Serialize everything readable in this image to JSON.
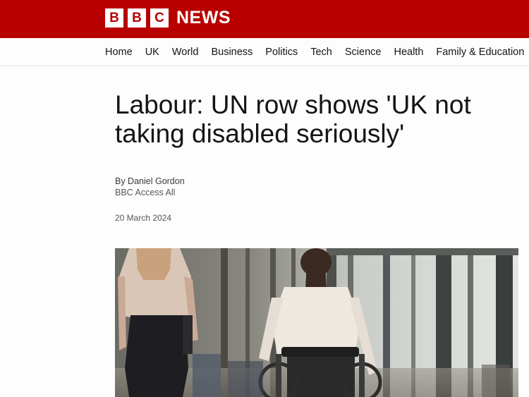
{
  "brand": {
    "letters": [
      "B",
      "B",
      "C"
    ],
    "news": "NEWS"
  },
  "nav": {
    "items": [
      "Home",
      "UK",
      "World",
      "Business",
      "Politics",
      "Tech",
      "Science",
      "Health",
      "Family & Education"
    ]
  },
  "article": {
    "headline": "Labour: UN row shows 'UK not taking disabled seriously'",
    "author": "By Daniel Gordon",
    "department": "BBC Access All",
    "date": "20 March 2024"
  },
  "colors": {
    "brand_red": "#b80000",
    "text": "#141414",
    "muted": "#545658"
  }
}
